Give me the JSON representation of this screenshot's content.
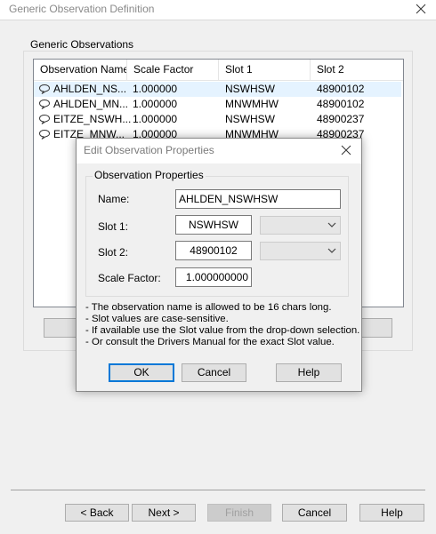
{
  "window": {
    "title": "Generic Observation Definition"
  },
  "group": {
    "caption": "Generic Observations"
  },
  "list": {
    "columns": [
      "Observation Name",
      "Scale Factor",
      "Slot 1",
      "Slot 2"
    ],
    "rows": [
      {
        "name": "AHLDEN_NS...",
        "scale": "1.000000",
        "slot1": "NSWHSW",
        "slot2": "48900102",
        "selected": true
      },
      {
        "name": "AHLDEN_MN...",
        "scale": "1.000000",
        "slot1": "MNWMHW",
        "slot2": "48900102",
        "selected": false
      },
      {
        "name": "EITZE_NSWH...",
        "scale": "1.000000",
        "slot1": "NSWHSW",
        "slot2": "48900237",
        "selected": false
      },
      {
        "name": "EITZE_MNW...",
        "scale": "1.000000",
        "slot1": "MNWMHW",
        "slot2": "48900237",
        "selected": false
      }
    ]
  },
  "dialog": {
    "title": "Edit Observation Properties",
    "group_caption": "Observation Properties",
    "name_label": "Name:",
    "name_value": "AHLDEN_NSWHSW",
    "slot1_label": "Slot 1:",
    "slot1_value": "NSWHSW",
    "slot2_label": "Slot 2:",
    "slot2_value": "48900102",
    "scale_label": "Scale Factor:",
    "scale_value": "1.000000000",
    "notes": [
      "- The observation name is allowed to be 16 chars long.",
      "- Slot values are case-sensitive.",
      "- If available use the Slot value from the drop-down selection.",
      "- Or consult the Drivers Manual for the exact Slot value."
    ],
    "ok_label": "OK",
    "cancel_label": "Cancel",
    "help_label": "Help"
  },
  "footer": {
    "back_label": "< Back",
    "next_label": "Next >",
    "finish_label": "Finish",
    "cancel_label": "Cancel",
    "help_label": "Help"
  },
  "icons": {
    "close": "close-icon",
    "row": "observation-icon",
    "dropdown": "chevron-down-icon"
  },
  "colors": {
    "selection": "#e5f3ff",
    "default_button_border": "#0078d7",
    "disabled_text": "#a0a0a0"
  }
}
